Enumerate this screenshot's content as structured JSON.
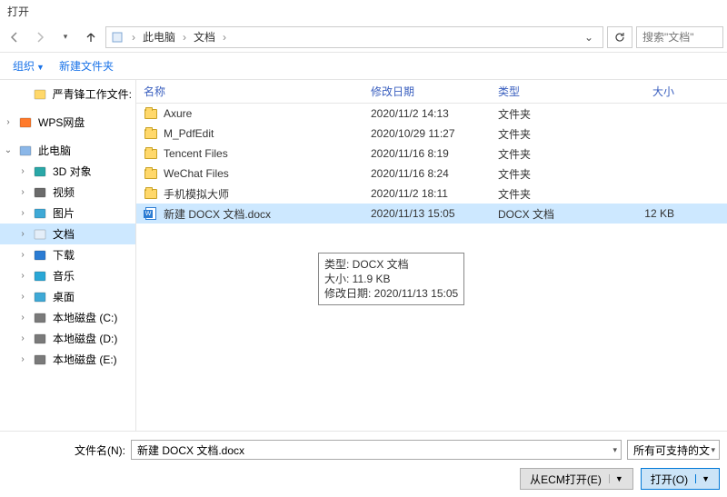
{
  "title": "打开",
  "breadcrumb": {
    "root": "此电脑",
    "seg1": "文档"
  },
  "nav": {
    "refresh": "↻"
  },
  "search": {
    "placeholder": "搜索\"文档\""
  },
  "toolbar": {
    "organize": "组织",
    "newfolder": "新建文件夹"
  },
  "tree": {
    "items": [
      {
        "label": "严青锋工作文件:",
        "icon": "folder",
        "level": 1
      },
      {
        "sep": true
      },
      {
        "label": "WPS网盘",
        "icon": "wps",
        "exp": ">",
        "level": 0
      },
      {
        "sep": true
      },
      {
        "label": "此电脑",
        "icon": "pc",
        "exp": "v",
        "level": 0
      },
      {
        "label": "3D 对象",
        "icon": "3d",
        "exp": ">",
        "level": 1
      },
      {
        "label": "视频",
        "icon": "video",
        "exp": ">",
        "level": 1
      },
      {
        "label": "图片",
        "icon": "pics",
        "exp": ">",
        "level": 1
      },
      {
        "label": "文档",
        "icon": "docs",
        "exp": ">",
        "level": 1,
        "sel": true
      },
      {
        "label": "下载",
        "icon": "down",
        "exp": ">",
        "level": 1
      },
      {
        "label": "音乐",
        "icon": "music",
        "exp": ">",
        "level": 1
      },
      {
        "label": "桌面",
        "icon": "desk",
        "exp": ">",
        "level": 1
      },
      {
        "label": "本地磁盘 (C:)",
        "icon": "disk",
        "exp": ">",
        "level": 1
      },
      {
        "label": "本地磁盘 (D:)",
        "icon": "disk",
        "exp": ">",
        "level": 1
      },
      {
        "label": "本地磁盘 (E:)",
        "icon": "disk",
        "exp": ">",
        "level": 1
      }
    ]
  },
  "columns": {
    "name": "名称",
    "date": "修改日期",
    "type": "类型",
    "size": "大小"
  },
  "files": [
    {
      "name": "Axure",
      "date": "2020/11/2 14:13",
      "type": "文件夹",
      "size": "",
      "icon": "folder"
    },
    {
      "name": "M_PdfEdit",
      "date": "2020/10/29 11:27",
      "type": "文件夹",
      "size": "",
      "icon": "folder"
    },
    {
      "name": "Tencent Files",
      "date": "2020/11/16 8:19",
      "type": "文件夹",
      "size": "",
      "icon": "folder"
    },
    {
      "name": "WeChat Files",
      "date": "2020/11/16 8:24",
      "type": "文件夹",
      "size": "",
      "icon": "folder"
    },
    {
      "name": "手机模拟大师",
      "date": "2020/11/2 18:11",
      "type": "文件夹",
      "size": "",
      "icon": "folder"
    },
    {
      "name": "新建 DOCX 文档.docx",
      "date": "2020/11/13 15:05",
      "type": "DOCX 文档",
      "size": "12 KB",
      "icon": "docx",
      "sel": true
    }
  ],
  "tooltip": {
    "l1": "类型: DOCX 文档",
    "l2": "大小: 11.9 KB",
    "l3": "修改日期: 2020/11/13 15:05"
  },
  "footer": {
    "fname_label": "文件名(N):",
    "fname_value": "新建 DOCX 文档.docx",
    "filter": "所有可支持的文",
    "ecm": "从ECM打开(E)",
    "open": "打开(O)"
  }
}
